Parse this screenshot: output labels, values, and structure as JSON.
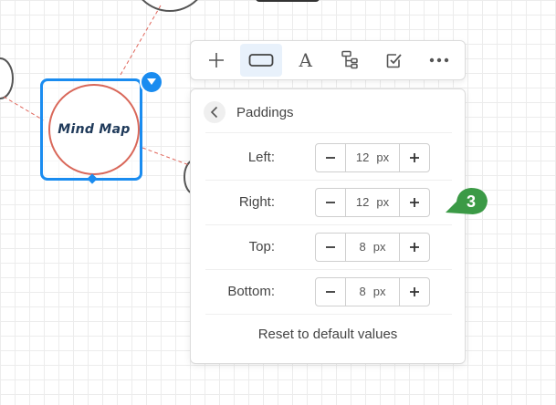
{
  "canvas": {
    "node": {
      "label": "Mind Map"
    }
  },
  "toolbar": {
    "buttons": [
      {
        "name": "add-icon",
        "active": false
      },
      {
        "name": "shape-icon",
        "active": true
      },
      {
        "name": "text-icon",
        "active": false
      },
      {
        "name": "layout-tree-icon",
        "active": false
      },
      {
        "name": "checkbox-icon",
        "active": false
      },
      {
        "name": "more-icon",
        "active": false
      }
    ],
    "text_glyph": "A"
  },
  "panel": {
    "title": "Paddings",
    "rows": [
      {
        "label": "Left:",
        "value": "12",
        "unit": "px"
      },
      {
        "label": "Right:",
        "value": "12",
        "unit": "px"
      },
      {
        "label": "Top:",
        "value": "8",
        "unit": "px"
      },
      {
        "label": "Bottom:",
        "value": "8",
        "unit": "px"
      }
    ],
    "reset_label": "Reset to default values"
  },
  "annotation": {
    "number": "3",
    "color": "#3b9a46"
  },
  "colors": {
    "accent": "#1a8cf0",
    "node_border": "#d9685a",
    "connector": "#e0655a"
  }
}
